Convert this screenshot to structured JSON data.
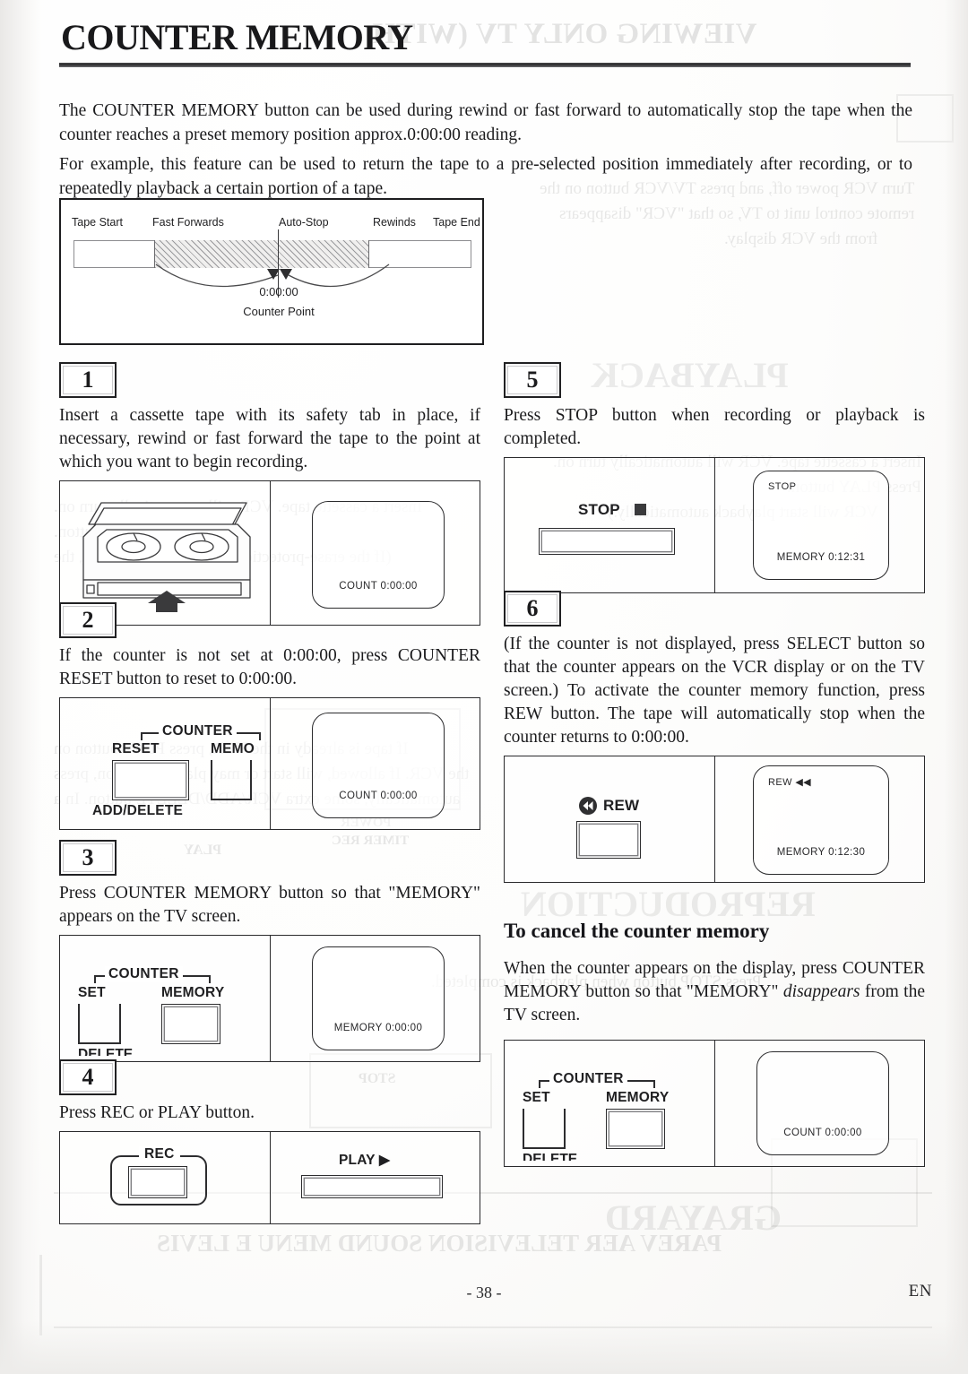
{
  "page": {
    "title": "COUNTER MEMORY",
    "footer_page_number": "- 38 -",
    "footer_language": "EN"
  },
  "intro": {
    "paragraph_1": "The COUNTER MEMORY button can be used during rewind or fast forward to automatically stop the tape when the counter reaches a preset memory position approx.0:00:00 reading.",
    "paragraph_2": "For example, this feature can be used to return the tape to a pre-selected position immediately after recording, or to repeatedly playback a certain portion of a tape."
  },
  "tape_diagram": {
    "label_tape_start": "Tape Start",
    "label_fast_forwards": "Fast Forwards",
    "label_auto_stop": "Auto-Stop",
    "label_rewinds": "Rewinds",
    "label_tape_end": "Tape End",
    "counter_value": "0:00:00",
    "counter_label": "Counter Point"
  },
  "steps": [
    {
      "number": "1",
      "text": "Insert a cassette tape with its safety tab in place, if necessary, rewind or fast forward the tape to the point at which you want to begin recording.",
      "figure_left": {
        "kind": "cassette-illustration"
      },
      "figure_right": {
        "kind": "tv-screen",
        "osd_top": "",
        "osd_bottom": "COUNT  0:00:00"
      }
    },
    {
      "number": "2",
      "text": "If the counter is not set at 0:00:00, press COUNTER RESET button to reset to 0:00:00.",
      "figure_left": {
        "kind": "vcr-controls",
        "bracket_label": "COUNTER",
        "button_1_label": "RESET",
        "button_1_sublabel": "ADD/DELETE",
        "button_2_label": "MEMO"
      },
      "figure_right": {
        "kind": "tv-screen",
        "osd_top": "",
        "osd_bottom": "COUNT  0:00:00"
      }
    },
    {
      "number": "3",
      "text": "Press COUNTER MEMORY button so that \"MEMORY\" appears on the TV screen.",
      "figure_left": {
        "kind": "vcr-controls",
        "bracket_label": "COUNTER",
        "button_1_label": "SET",
        "button_1_sublabel": "DELETE",
        "button_2_label": "MEMORY"
      },
      "figure_right": {
        "kind": "tv-screen",
        "osd_top": "",
        "osd_bottom": "MEMORY  0:00:00"
      }
    },
    {
      "number": "4",
      "text": "Press REC or PLAY button.",
      "figure_left": {
        "kind": "rec-button",
        "label": "REC"
      },
      "figure_right": {
        "kind": "play-button",
        "label": "PLAY ▶"
      }
    },
    {
      "number": "5",
      "text": "Press STOP button when recording or playback is completed.",
      "figure_left": {
        "kind": "stop-button",
        "label": "STOP"
      },
      "figure_right": {
        "kind": "tv-screen",
        "osd_top": "STOP",
        "osd_bottom": "MEMORY  0:12:31"
      }
    },
    {
      "number": "6",
      "text": "(If the counter is not displayed, press SELECT button so that the counter appears on the VCR display or on the TV screen.) To activate the counter memory function, press REW button. The tape will automatically stop when the counter returns to 0:00:00.",
      "figure_left": {
        "kind": "rew-button",
        "label": "REW"
      },
      "figure_right": {
        "kind": "tv-screen",
        "osd_top": "REW  ◀◀",
        "osd_bottom": "MEMORY  0:12:30"
      }
    }
  ],
  "cancel_section": {
    "heading": "To cancel the counter memory",
    "text_before_italic": "When the counter appears on the display, press COUNTER MEMORY button so that \"MEMORY\" ",
    "italic_word": "disappears",
    "text_after_italic": " from the TV screen.",
    "figure_left": {
      "kind": "vcr-controls",
      "bracket_label": "COUNTER",
      "button_1_label": "SET",
      "button_1_sublabel": "DELETE",
      "button_2_label": "MEMORY"
    },
    "figure_right": {
      "kind": "tv-screen",
      "osd_top": "",
      "osd_bottom": "COUNT  0:00:00"
    }
  },
  "show_through": {
    "note": "Mirrored text bleeding through from the reverse side of the page",
    "header": "VIEWING ONLY TV (WITH",
    "fragments": [
      "Turn VCR power off, and press TV/VCR button on the",
      "remote control unit to TV, so that \"VCR\" disappears",
      "from the VCR display.",
      "PLAYBACK",
      "Insert a cassette tape. VCR will automatically turn on.",
      "Press PLAY button.",
      "(If the erase-protection tab has been removed, the",
      "VCR will start playback automatically.)",
      "REPRODUCTION",
      "Press STOP button when playback is completed.",
      "If tape is already in the VCR, press PLAY button on",
      "the VCR. If allowed, will start or may playback button, press",
      "automatically, some extra VCR/ADD/DELETE button. In a",
      "PLAY",
      "TIMER REC",
      "POWER",
      "STOP",
      "GRAYARD",
      "PAREV AER TELEVISION SOUND MENU E LEVIS"
    ]
  }
}
